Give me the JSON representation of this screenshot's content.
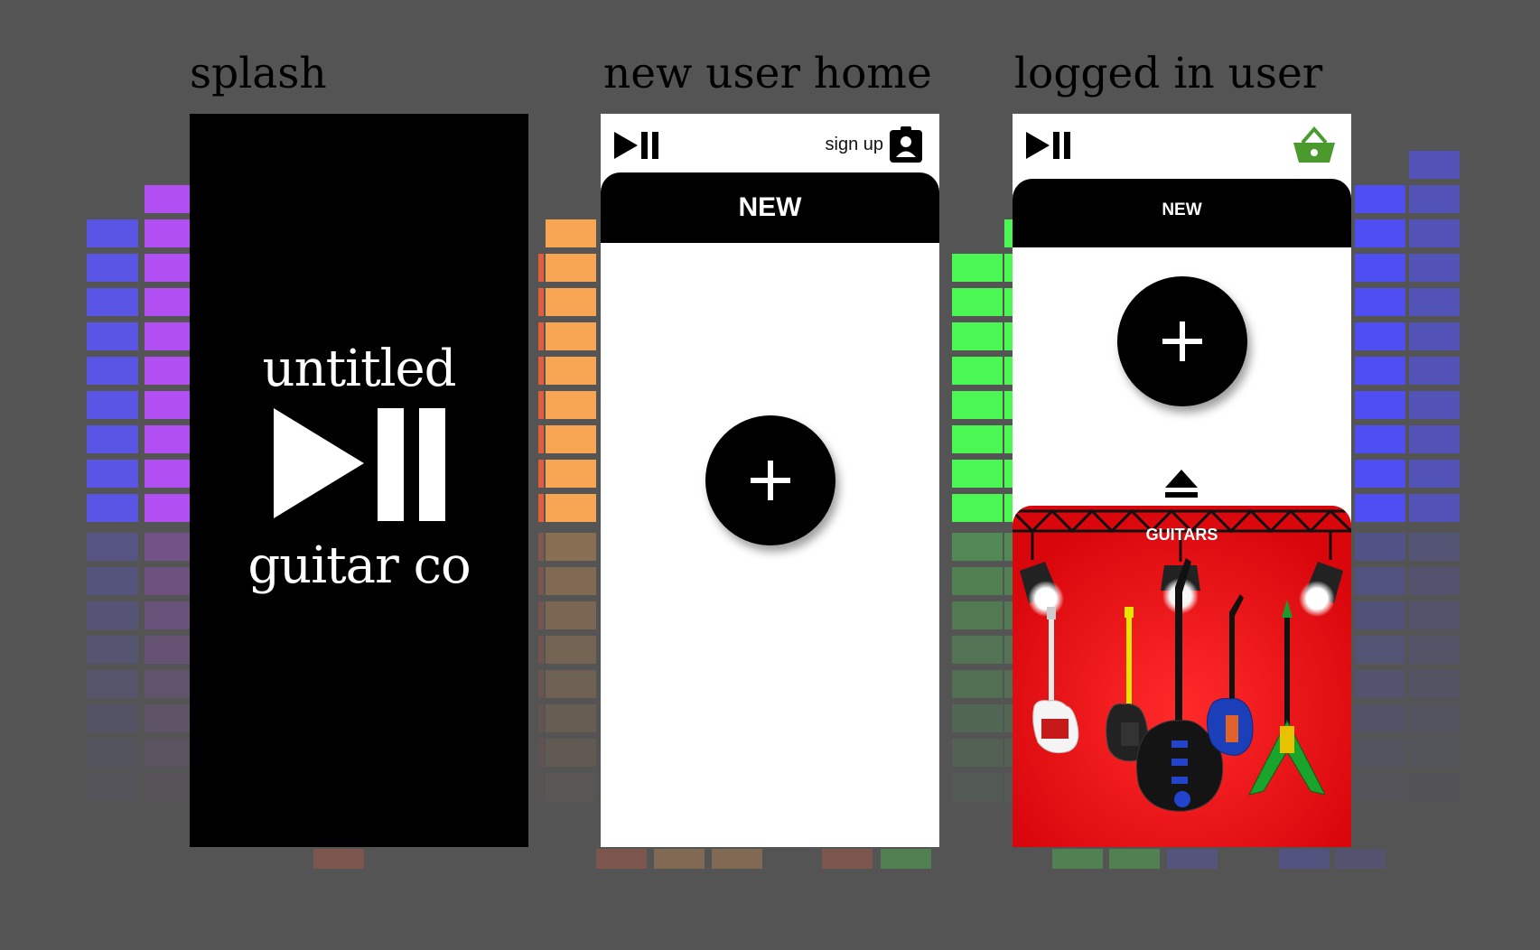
{
  "captions": {
    "splash": "splash",
    "new_user_home": "new user home",
    "logged_in_user": "logged in user"
  },
  "splash": {
    "brand_top": "untitled",
    "brand_bottom": "guitar co",
    "logo_icon": "play-pause-icon"
  },
  "new_user_home": {
    "logo_icon": "play-pause-icon",
    "signup_label": "sign up",
    "signup_icon": "user-badge-icon",
    "section_title": "NEW",
    "add_icon": "plus-icon"
  },
  "logged_in_user": {
    "logo_icon": "play-pause-icon",
    "cart_icon": "basket-icon",
    "section_title": "NEW",
    "add_icon": "plus-icon",
    "expand_icon": "eject-icon",
    "category_title": "GUITARS"
  },
  "colors": {
    "background": "#545454",
    "equalizer": [
      "#5b55e6",
      "#b14ff2",
      "#e25c3e",
      "#f7a552",
      "#4bf753",
      "#4e4ef2",
      "#5353b7"
    ],
    "guitars_stage": "#ee0f15",
    "basket": "#4a9a2e"
  }
}
